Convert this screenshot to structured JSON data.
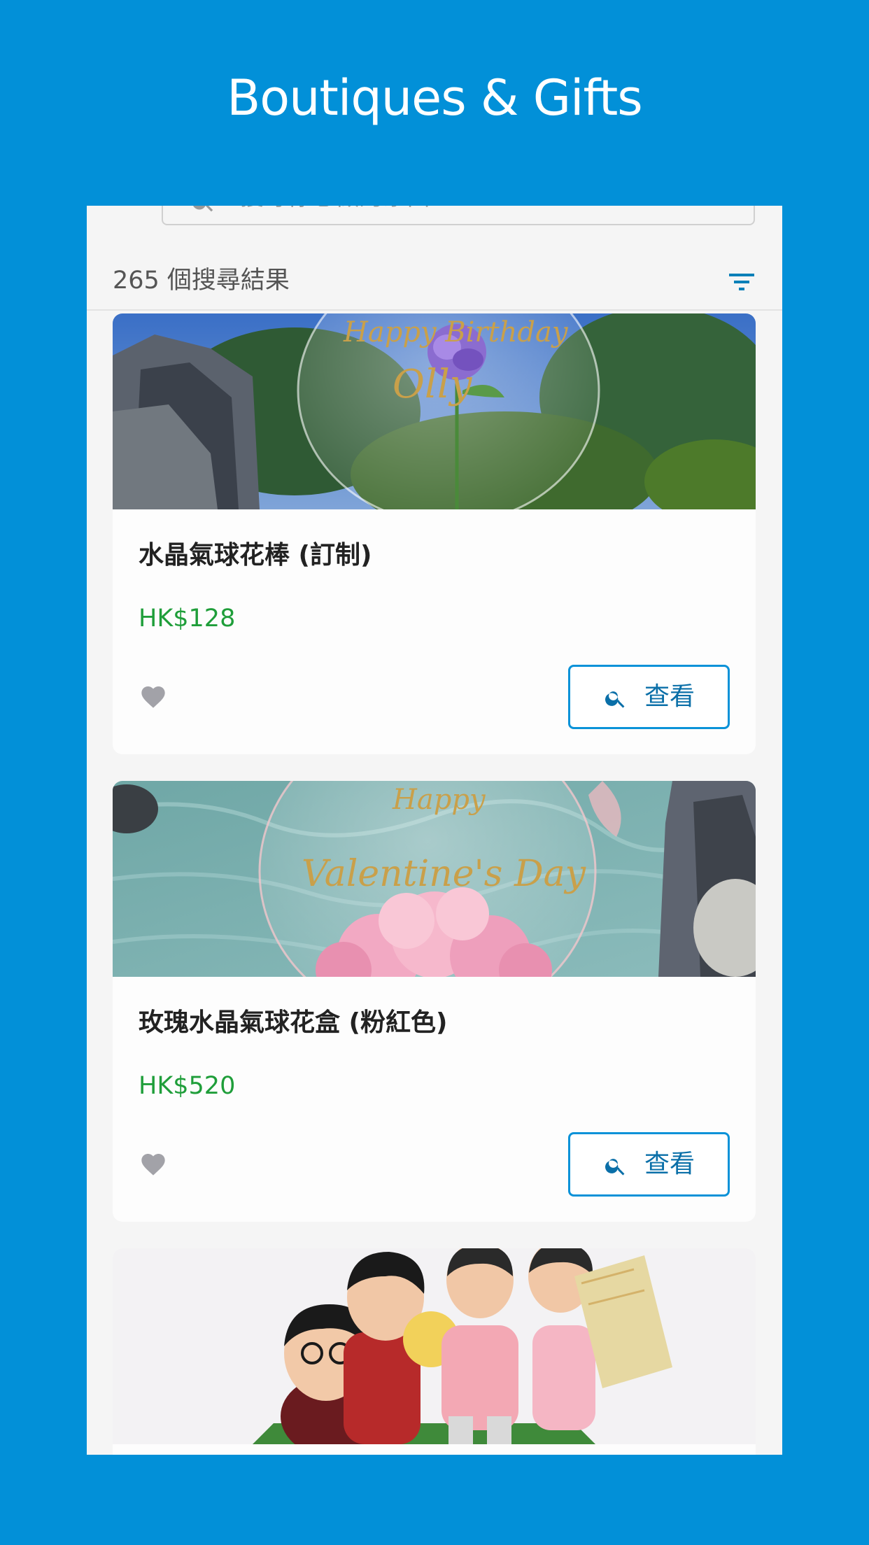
{
  "header": {
    "title": "Boutiques & Gifts"
  },
  "search": {
    "placeholder": "搜尋你想做的东西"
  },
  "results": {
    "count_label": "265 個搜尋結果"
  },
  "products": [
    {
      "title": "水晶氣球花棒 (訂制)",
      "price": "HK$128",
      "button_label": "查看",
      "image_text_1": "Happy Birthday",
      "image_text_2": "Olly"
    },
    {
      "title": "玫瑰水晶氣球花盒 (粉紅色)",
      "price": "HK$520",
      "button_label": "查看",
      "image_text_1": "Happy",
      "image_text_2": "Valentine's Day"
    },
    {
      "title": "",
      "price": "",
      "button_label": ""
    }
  ],
  "colors": {
    "background": "#0290d8",
    "accent": "#0a92d8",
    "price": "#1f9e3a"
  },
  "icons": {
    "search": "search-icon",
    "filter": "filter-icon",
    "heart": "heart-icon"
  }
}
